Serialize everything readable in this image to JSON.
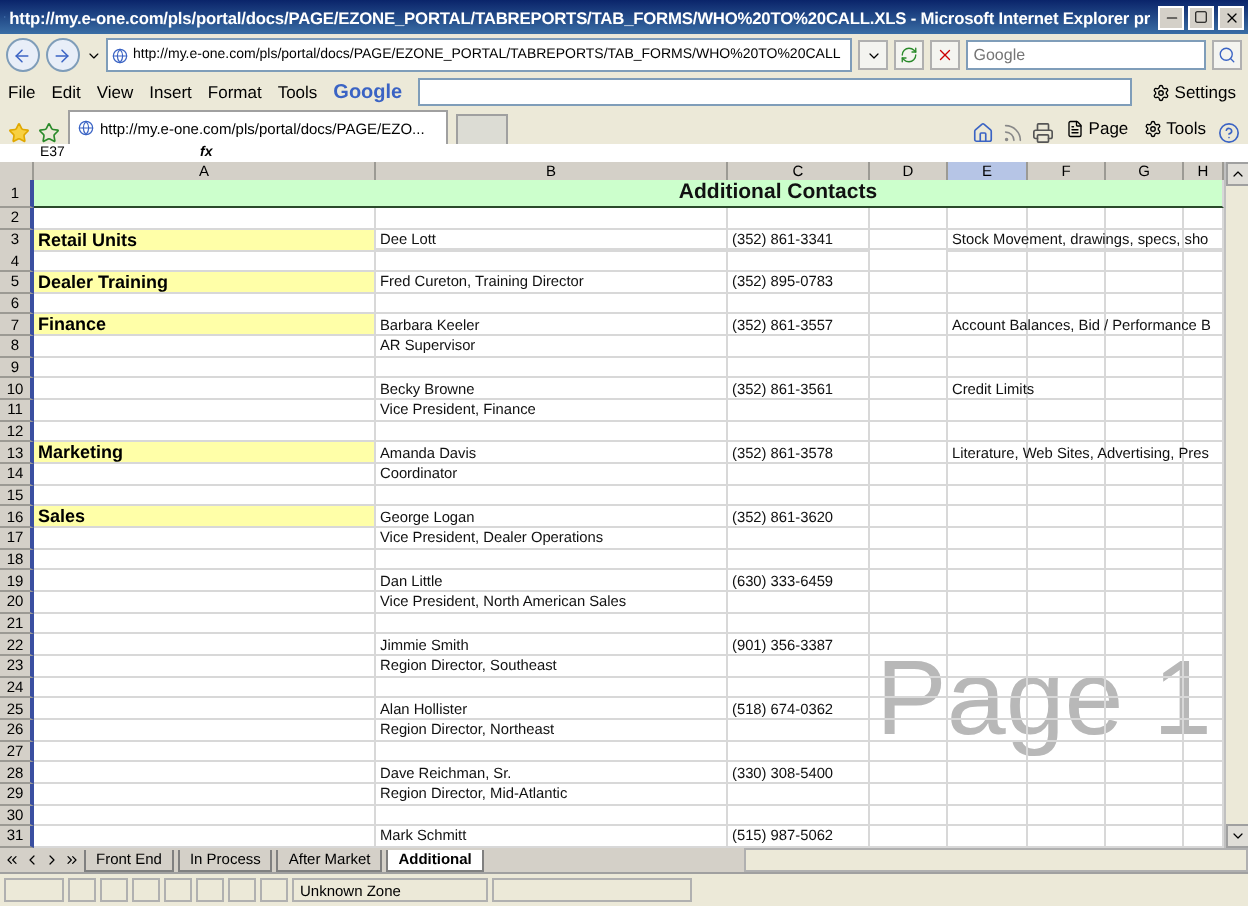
{
  "window": {
    "title": "http://my.e-one.com/pls/portal/docs/PAGE/EZONE_PORTAL/TABREPORTS/TAB_FORMS/WHO%20TO%20CALL.XLS - Microsoft Internet Explorer pr"
  },
  "address_bar": {
    "url": "http://my.e-one.com/pls/portal/docs/PAGE/EZONE_PORTAL/TABREPORTS/TAB_FORMS/WHO%20TO%20CALL"
  },
  "search": {
    "placeholder": "Google"
  },
  "menu": [
    "File",
    "Edit",
    "View",
    "Insert",
    "Format",
    "Tools"
  ],
  "google_toolbar": {
    "logo": "Google",
    "settings": "Settings"
  },
  "browser_tab": {
    "title": "http://my.e-one.com/pls/portal/docs/PAGE/EZO..."
  },
  "command_bar": [
    "Page",
    "Tools"
  ],
  "name_box": "E37",
  "formula_label": "fx",
  "columns": [
    {
      "label": "A",
      "selected": false
    },
    {
      "label": "B",
      "selected": false
    },
    {
      "label": "C",
      "selected": false
    },
    {
      "label": "D",
      "selected": false
    },
    {
      "label": "E",
      "selected": true
    },
    {
      "label": "F",
      "selected": false
    },
    {
      "label": "G",
      "selected": false
    },
    {
      "label": "H",
      "selected": false
    }
  ],
  "sheet": {
    "title": "Additional Contacts",
    "rows": [
      {
        "number": "1"
      },
      {
        "number": "2"
      },
      {
        "number": "3",
        "a": "Retail Units",
        "b": "Dee Lott",
        "c": "(352) 861-3341",
        "e": "Stock Movement, drawings, specs, sho"
      },
      {
        "number": "4"
      },
      {
        "number": "5",
        "a": "Dealer Training",
        "b": "Fred Cureton, Training Director",
        "c": "(352) 895-0783"
      },
      {
        "number": "6"
      },
      {
        "number": "7",
        "a": "Finance",
        "b": "Barbara Keeler",
        "c": "(352) 861-3557",
        "e": "Account Balances, Bid / Performance B"
      },
      {
        "number": "8",
        "b": "AR Supervisor"
      },
      {
        "number": "9"
      },
      {
        "number": "10",
        "b": "Becky Browne",
        "c": "(352) 861-3561",
        "e": "Credit Limits"
      },
      {
        "number": "11",
        "b": "Vice President, Finance"
      },
      {
        "number": "12"
      },
      {
        "number": "13",
        "a": "Marketing",
        "b": "Amanda Davis",
        "c": "(352) 861-3578",
        "e": "Literature, Web Sites, Advertising, Pres"
      },
      {
        "number": "14",
        "b": "Coordinator"
      },
      {
        "number": "15"
      },
      {
        "number": "16",
        "a": "Sales",
        "b": "George Logan",
        "c": "(352) 861-3620"
      },
      {
        "number": "17",
        "b": "Vice President, Dealer Operations"
      },
      {
        "number": "18"
      },
      {
        "number": "19",
        "b": "Dan Little",
        "c": "(630) 333-6459"
      },
      {
        "number": "20",
        "b": "Vice President, North American Sales"
      },
      {
        "number": "21"
      },
      {
        "number": "22",
        "b": "Jimmie Smith",
        "c": "(901) 356-3387"
      },
      {
        "number": "23",
        "b": "Region Director, Southeast"
      },
      {
        "number": "24"
      },
      {
        "number": "25",
        "b": "Alan Hollister",
        "c": "(518) 674-0362"
      },
      {
        "number": "26",
        "b": "Region Director, Northeast"
      },
      {
        "number": "27"
      },
      {
        "number": "28",
        "b": "Dave Reichman, Sr.",
        "c": "(330) 308-5400"
      },
      {
        "number": "29",
        "b": "Region Director, Mid-Atlantic"
      },
      {
        "number": "30"
      },
      {
        "number": "31",
        "b": "Mark Schmitt",
        "c": "(515) 987-5062"
      }
    ]
  },
  "page_overlay": "Page 1",
  "sheet_tabs": [
    {
      "label": "Front End",
      "selected": false
    },
    {
      "label": "In Process",
      "selected": false
    },
    {
      "label": "After Market",
      "selected": false
    },
    {
      "label": "Additional",
      "selected": true
    }
  ],
  "status_bar": {
    "zone": "Unknown Zone"
  }
}
